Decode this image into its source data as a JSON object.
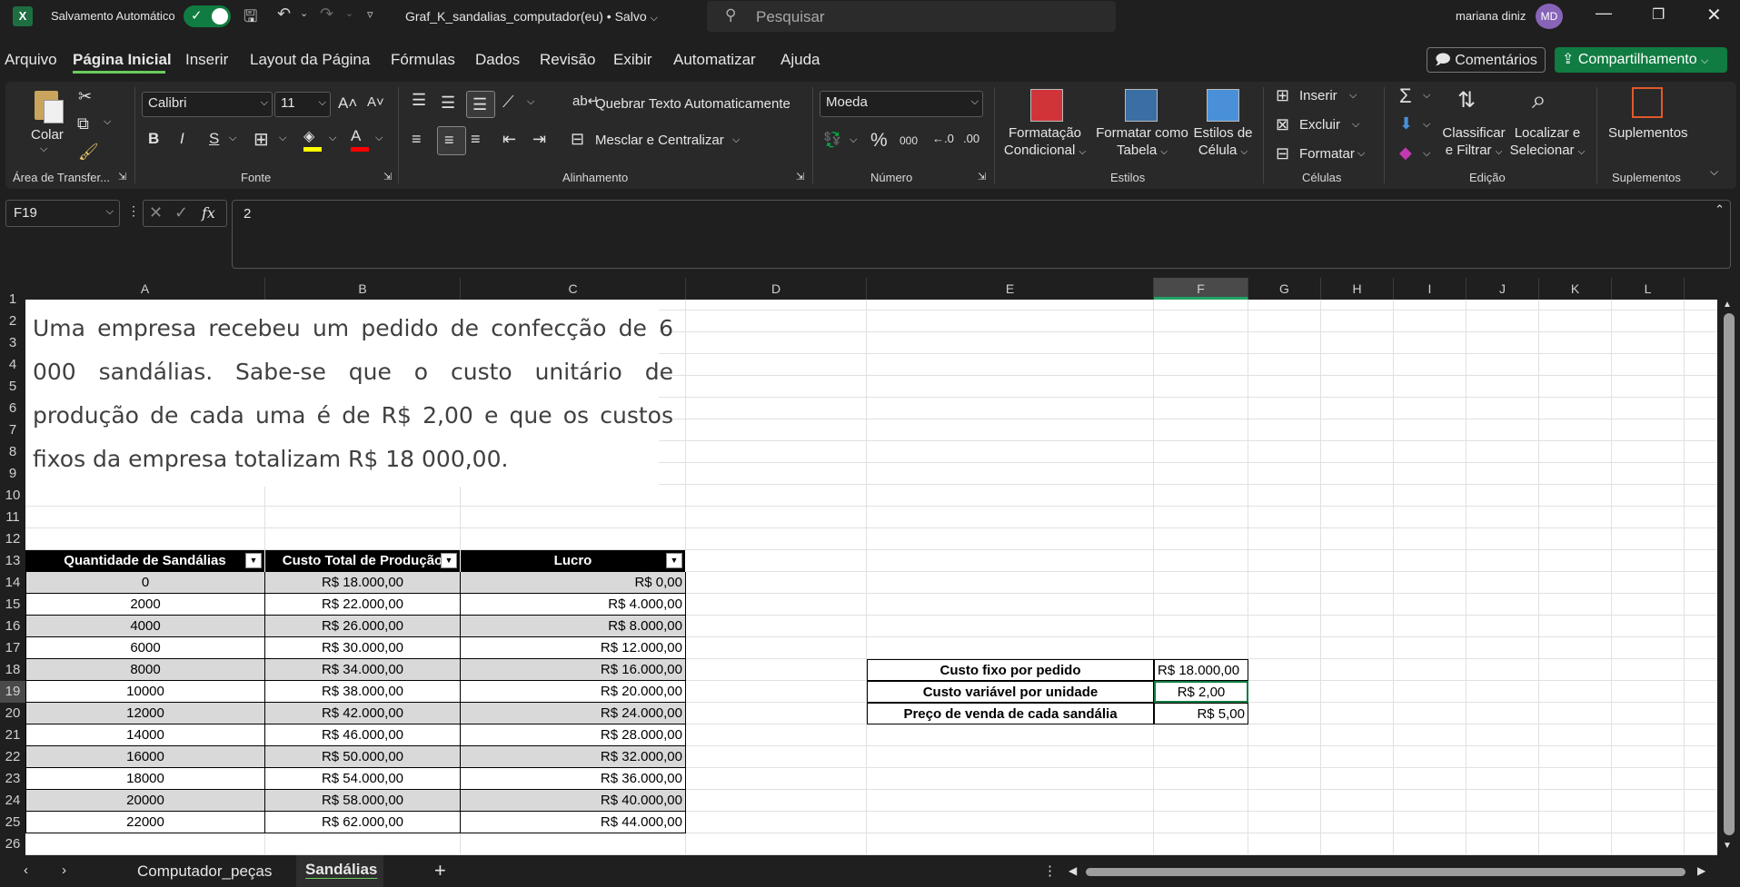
{
  "titlebar": {
    "app_icon": "X",
    "autosave_label": "Salvamento Automático",
    "file_title": "Graf_K_sandalias_computador(eu) • Salvo",
    "search_placeholder": "Pesquisar",
    "user_name": "mariana diniz",
    "user_initials": "MD"
  },
  "menu": {
    "tabs": [
      "Arquivo",
      "Página Inicial",
      "Inserir",
      "Layout da Página",
      "Fórmulas",
      "Dados",
      "Revisão",
      "Exibir",
      "Automatizar",
      "Ajuda"
    ],
    "active": "Página Inicial",
    "comments": "Comentários",
    "share": "Compartilhamento"
  },
  "ribbon": {
    "clipboard": {
      "paste": "Colar",
      "label": "Área de Transfer..."
    },
    "font": {
      "name": "Calibri",
      "size": "11",
      "label": "Fonte",
      "bold": "B",
      "italic": "I",
      "underline": "S"
    },
    "alignment": {
      "wrap": "Quebrar Texto Automaticamente",
      "merge": "Mesclar e Centralizar",
      "label": "Alinhamento"
    },
    "number": {
      "format": "Moeda",
      "label": "Número",
      "percent": "%",
      "thousands": "000"
    },
    "styles": {
      "conditional": [
        "Formatação",
        "Condicional"
      ],
      "as_table": [
        "Formatar como",
        "Tabela"
      ],
      "cell_styles": [
        "Estilos de",
        "Célula"
      ],
      "label": "Estilos"
    },
    "cells": {
      "insert": "Inserir",
      "delete": "Excluir",
      "format": "Formatar",
      "label": "Células"
    },
    "editing": {
      "sort": [
        "Classificar",
        "e Filtrar"
      ],
      "find": [
        "Localizar e",
        "Selecionar"
      ],
      "label": "Edição"
    },
    "addins": {
      "button": "Suplementos",
      "label": "Suplementos"
    }
  },
  "formula_bar": {
    "name_box": "F19",
    "fx": "fx",
    "value": "2"
  },
  "grid": {
    "columns": [
      "A",
      "B",
      "C",
      "D",
      "E",
      "F",
      "G",
      "H",
      "I",
      "J",
      "K",
      "L"
    ],
    "selected_column": "F",
    "rows": [
      "1",
      "2",
      "3",
      "4",
      "5",
      "6",
      "7",
      "8",
      "9",
      "10",
      "11",
      "12",
      "13",
      "14",
      "15",
      "16",
      "17",
      "18",
      "19",
      "20",
      "21",
      "22",
      "23",
      "24",
      "25",
      "26"
    ],
    "selected_row": "19"
  },
  "problem_text": "Uma empresa recebeu um pedido de confecção de 6 000 sandálias. Sabe-se que o custo unitário de produção de cada uma é de R$ 2,00 e que os custos fixos da empresa totalizam R$ 18 000,00.",
  "table": {
    "headers": [
      "Quantidade de Sandálias",
      "Custo Total de Produção",
      "Lucro"
    ],
    "rows": [
      [
        "0",
        "R$ 18.000,00",
        "R$ 0,00"
      ],
      [
        "2000",
        "R$ 22.000,00",
        "R$ 4.000,00"
      ],
      [
        "4000",
        "R$ 26.000,00",
        "R$ 8.000,00"
      ],
      [
        "6000",
        "R$ 30.000,00",
        "R$ 12.000,00"
      ],
      [
        "8000",
        "R$ 34.000,00",
        "R$ 16.000,00"
      ],
      [
        "10000",
        "R$ 38.000,00",
        "R$ 20.000,00"
      ],
      [
        "12000",
        "R$ 42.000,00",
        "R$ 24.000,00"
      ],
      [
        "14000",
        "R$ 46.000,00",
        "R$ 28.000,00"
      ],
      [
        "16000",
        "R$ 50.000,00",
        "R$ 32.000,00"
      ],
      [
        "18000",
        "R$ 54.000,00",
        "R$ 36.000,00"
      ],
      [
        "20000",
        "R$ 58.000,00",
        "R$ 40.000,00"
      ],
      [
        "22000",
        "R$ 62.000,00",
        "R$ 44.000,00"
      ]
    ]
  },
  "params": [
    {
      "label": "Custo fixo por pedido",
      "value": "R$ 18.000,00"
    },
    {
      "label": "Custo variável por unidade",
      "value": "R$ 2,00"
    },
    {
      "label": "Preço de venda de cada sandália",
      "value": "R$ 5,00"
    }
  ],
  "sheet_tabs": [
    "Computador_peças",
    "Sandálias"
  ],
  "active_sheet": "Sandálias",
  "colors": {
    "excel_green": "#107c41",
    "accent_green": "#21a366",
    "header_black": "#000000",
    "stripe_grey": "#d9d9d9",
    "avatar_purple": "#8764b8"
  }
}
